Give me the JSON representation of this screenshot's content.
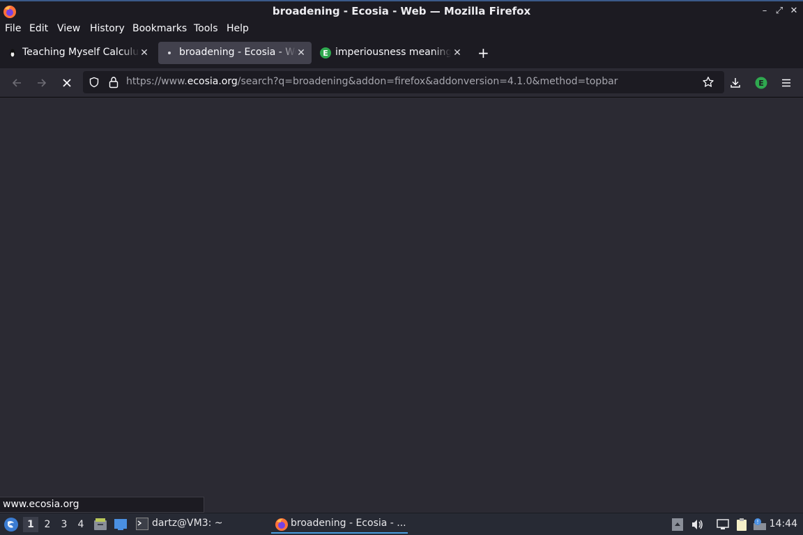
{
  "window": {
    "title": "broadening - Ecosia - Web — Mozilla Firefox",
    "minimize": "–",
    "maximize": "⤢",
    "close": "✕"
  },
  "menubar": {
    "items": [
      {
        "label": "File"
      },
      {
        "label": "Edit"
      },
      {
        "label": "View"
      },
      {
        "label": "History"
      },
      {
        "label": "Bookmarks"
      },
      {
        "label": "Tools"
      },
      {
        "label": "Help"
      }
    ]
  },
  "tabs": [
    {
      "label": "Teaching Myself Calculus",
      "icon": "penguin-icon",
      "active": false
    },
    {
      "label": "broadening - Ecosia - Web",
      "icon": "loading-dot-icon",
      "active": true
    },
    {
      "label": "imperiousness meaning",
      "icon": "ecosia-icon",
      "active": false
    }
  ],
  "new_tab_label": "+",
  "navbar": {
    "url_prefix": "https://www.",
    "url_host": "ecosia.org",
    "url_rest": "/search?q=broadening&addon=firefox&addonversion=4.1.0&method=topbar"
  },
  "status_text": "www.ecosia.org",
  "taskbar": {
    "workspaces": [
      "1",
      "2",
      "3",
      "4"
    ],
    "active_workspace": "1",
    "terminal_task": "dartz@VM3: ~",
    "firefox_task": "broadening - Ecosia - ...",
    "clock": "14:44"
  },
  "colors": {
    "accent": "#4a9ee0",
    "ecosia_green": "#2fa84f",
    "firefox_orange": "#ff7139"
  }
}
